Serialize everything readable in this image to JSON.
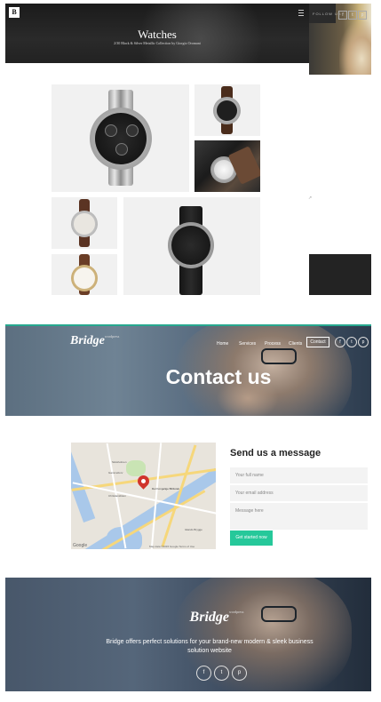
{
  "watches_page": {
    "brand_letter": "B",
    "title": "Watches",
    "subtitle": "2/30 Black & Silver Metallic Collection by Giorgio Oromani",
    "follow_label": "FOLLOW US",
    "social_icons": [
      "f",
      "t",
      "p"
    ]
  },
  "contact_page": {
    "logo": "Bridge",
    "logo_tag": "wordpress",
    "nav": [
      "Home",
      "Services",
      "Process",
      "Clients",
      "Contact"
    ],
    "social_icons": [
      "f",
      "t",
      "p"
    ],
    "title": "Contact us",
    "map": {
      "place_label": "Det Kongelige Bibliotek",
      "street_labels": [
        "Slotsholmen",
        "Gammeltorv",
        "Christianshavn",
        "Islands Brygge"
      ],
      "google": "Google",
      "footer": "Map data ©2015 Google   Terms of Use"
    },
    "form": {
      "title": "Send us a message",
      "name_placeholder": "Your full name",
      "email_placeholder": "Your email address",
      "message_placeholder": "Message here",
      "submit": "Get started now"
    },
    "footer": {
      "logo": "Bridge",
      "logo_tag": "wordpress",
      "text": "Bridge offers perfect solutions for your brand-new modern & sleek business solution website",
      "social_icons": [
        "f",
        "t",
        "p"
      ]
    }
  },
  "colors": {
    "accent_green": "#26c89a",
    "hero_top_line": "#27a88f",
    "map_pin": "#d0342c"
  }
}
